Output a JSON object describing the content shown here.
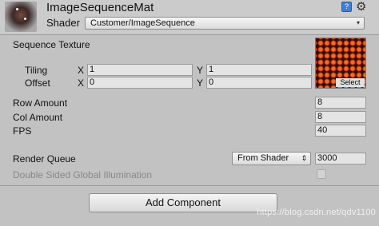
{
  "header": {
    "material_name": "ImageSequenceMat",
    "shader_label": "Shader",
    "shader_value": "Customer/ImageSequence",
    "help_glyph": "?",
    "dropdown_glyph": "▾"
  },
  "sequence_texture": {
    "label": "Sequence Texture",
    "select_label": "Select"
  },
  "tiling": {
    "label": "Tiling",
    "x_label": "X",
    "x": "1",
    "y_label": "Y",
    "y": "1"
  },
  "offset": {
    "label": "Offset",
    "x_label": "X",
    "x": "0",
    "y_label": "Y",
    "y": "0"
  },
  "row_amount": {
    "label": "Row Amount",
    "value": "8"
  },
  "col_amount": {
    "label": "Col Amount",
    "value": "8"
  },
  "fps": {
    "label": "FPS",
    "value": "40"
  },
  "render_queue": {
    "label": "Render Queue",
    "mode": "From Shader",
    "mode_glyph": "⇕",
    "value": "3000"
  },
  "double_sided_gi": {
    "label": "Double Sided Global Illumination",
    "checked": false
  },
  "add_component_label": "Add Component",
  "watermark": "https://blog.csdn.net/qdv1100",
  "icons": [
    "material-thumbnail-icon",
    "help-icon",
    "gear-icon",
    "dropdown-arrow-icon",
    "texture-preview"
  ],
  "colors": {
    "panel_bg": "#c2c2c2",
    "header_bg": "#cbcbcb",
    "field_bg": "#e4e4e4",
    "help_blue": "#3e7fd9"
  }
}
